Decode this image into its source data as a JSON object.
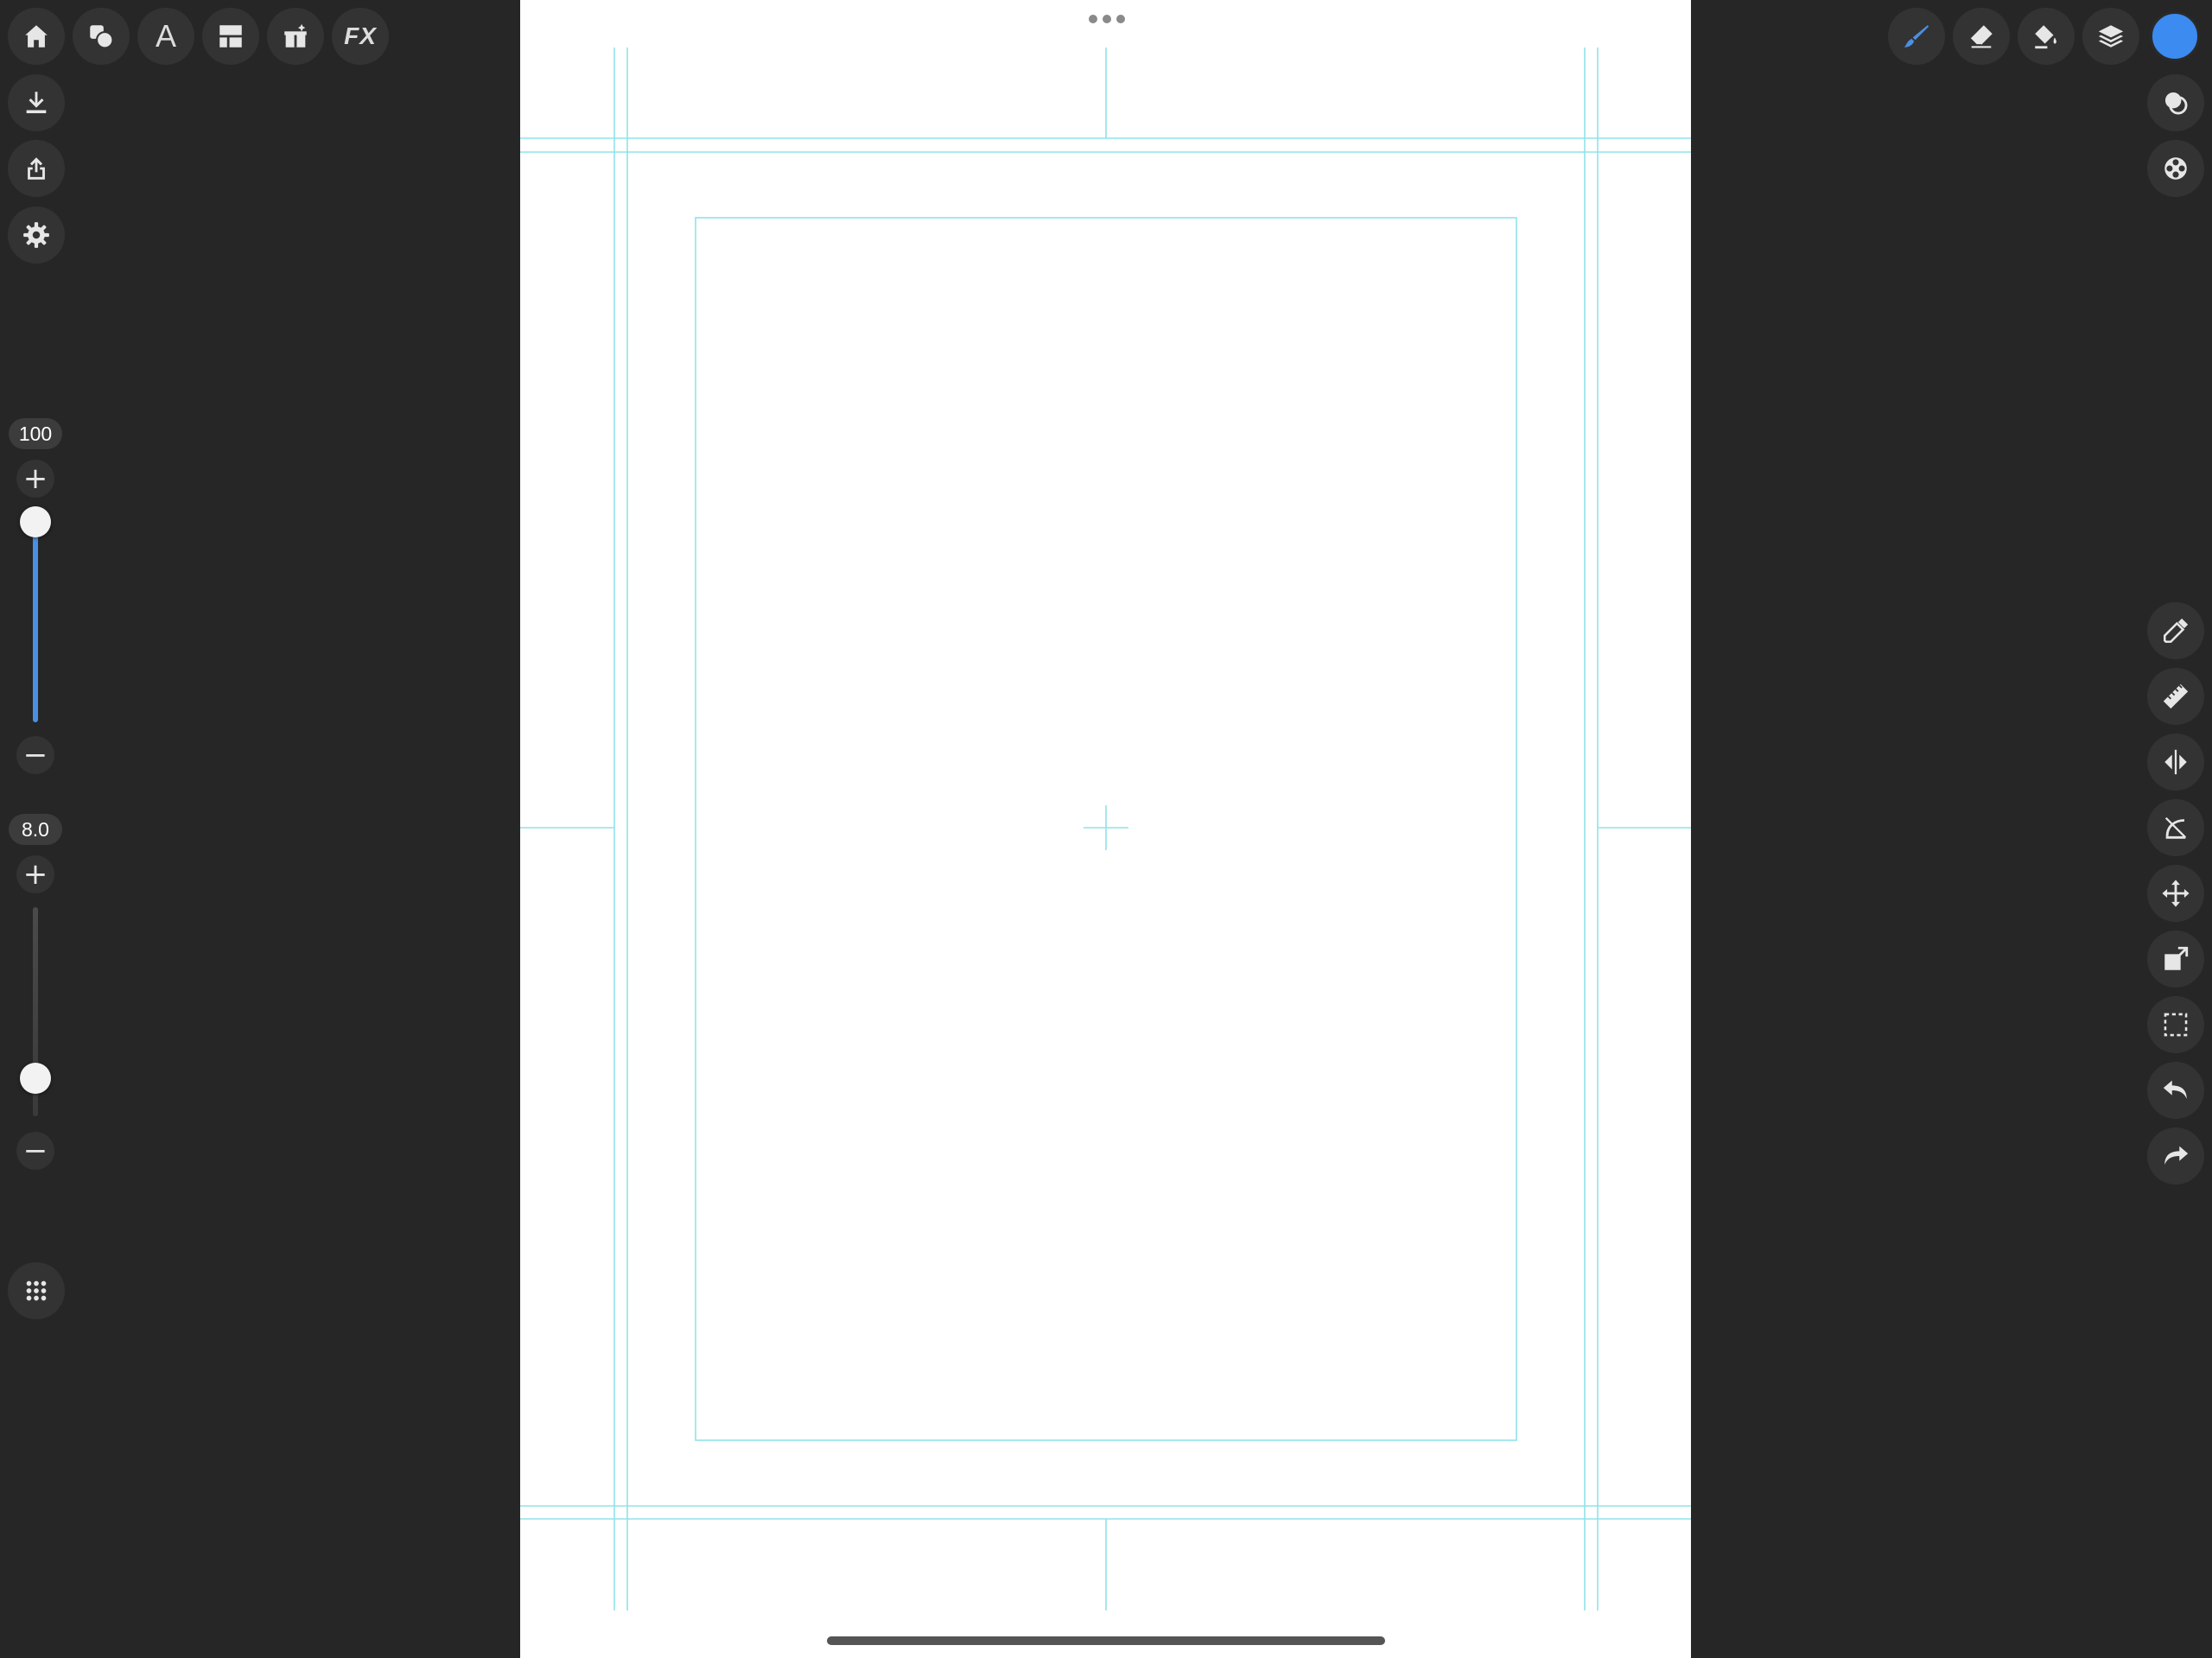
{
  "top_toolbar_left": [
    {
      "name": "home-icon"
    },
    {
      "name": "shapes-icon"
    },
    {
      "name": "text-icon",
      "glyph": "A"
    },
    {
      "name": "layout-icon"
    },
    {
      "name": "gift-magic-icon"
    },
    {
      "name": "fx-icon",
      "glyph": "FX"
    }
  ],
  "side_actions": [
    {
      "name": "download-icon"
    },
    {
      "name": "share-icon"
    },
    {
      "name": "settings-icon"
    }
  ],
  "opacity_slider": {
    "value_label": "100",
    "value": 100,
    "plus": "+",
    "minus": "−",
    "fill_color": "#4a90e2"
  },
  "size_slider": {
    "value_label": "8.0",
    "value": 8.0,
    "plus": "+",
    "minus": "−"
  },
  "top_toolbar_right": [
    {
      "name": "brush-icon",
      "active": true,
      "accent": "#4a90e2"
    },
    {
      "name": "eraser-icon"
    },
    {
      "name": "fill-bucket-icon"
    },
    {
      "name": "layers-icon"
    }
  ],
  "current_color": "#3b8bf0",
  "right_upper_tools": [
    {
      "name": "blend-icon"
    },
    {
      "name": "color-wheel-icon"
    }
  ],
  "right_tools": [
    {
      "name": "eyedropper-icon"
    },
    {
      "name": "ruler-icon"
    },
    {
      "name": "symmetry-icon"
    },
    {
      "name": "perspective-icon"
    },
    {
      "name": "move-icon"
    },
    {
      "name": "transform-icon"
    },
    {
      "name": "selection-icon"
    },
    {
      "name": "undo-icon"
    },
    {
      "name": "redo-icon"
    }
  ],
  "grid_menu": {
    "name": "grid-menu-icon"
  },
  "guide_color": "#8fe3ea"
}
